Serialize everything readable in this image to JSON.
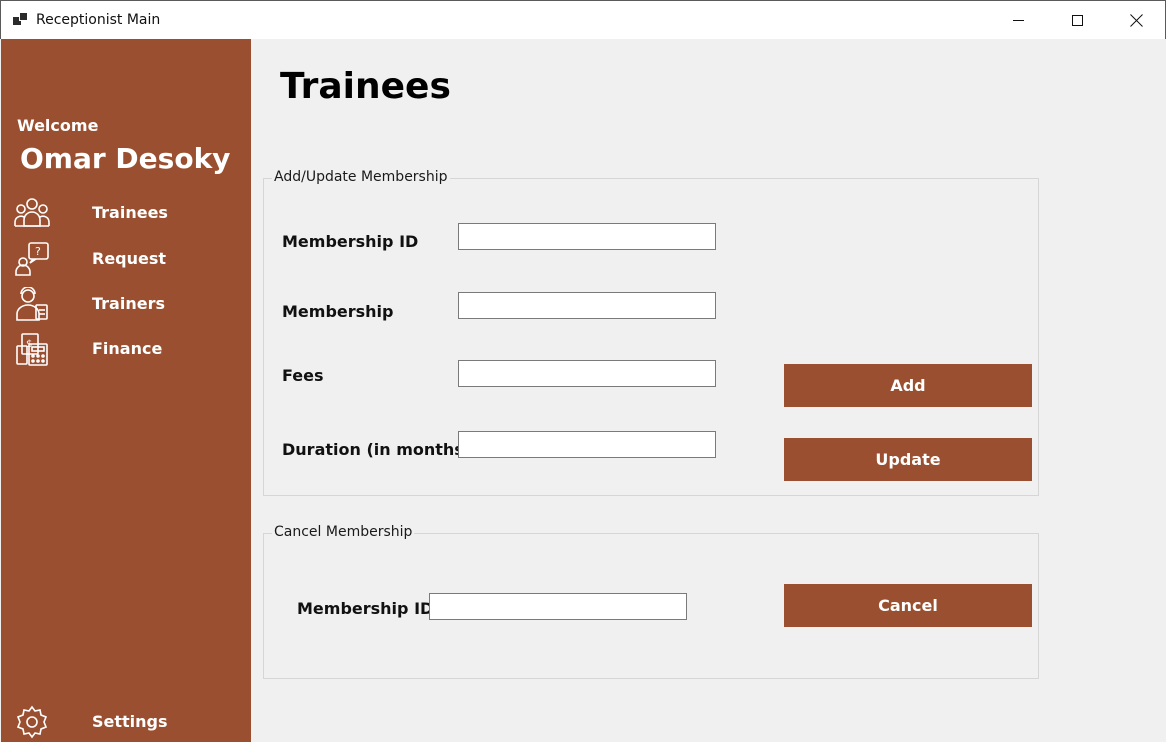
{
  "window": {
    "title": "Receptionist Main"
  },
  "sidebar": {
    "welcome": "Welcome",
    "user_name": "Omar Desoky",
    "items": [
      {
        "label": "Trainees",
        "icon": "trainees-group-icon"
      },
      {
        "label": "Request",
        "icon": "request-question-icon"
      },
      {
        "label": "Trainers",
        "icon": "trainer-icon"
      },
      {
        "label": "Finance",
        "icon": "finance-calculator-icon"
      }
    ],
    "settings": {
      "label": "Settings",
      "icon": "gear-icon"
    }
  },
  "main": {
    "title": "Trainees",
    "add_update_group": {
      "legend": "Add/Update Membership",
      "fields": [
        {
          "label": "Membership ID",
          "value": ""
        },
        {
          "label": "Membership",
          "value": ""
        },
        {
          "label": "Fees",
          "value": ""
        },
        {
          "label": "Duration (in months)",
          "value": ""
        }
      ],
      "add_button": "Add",
      "update_button": "Update"
    },
    "cancel_group": {
      "legend": "Cancel Membership",
      "field_label": "Membership ID",
      "field_value": "",
      "cancel_button": "Cancel"
    }
  },
  "colors": {
    "accent": "#9a5030",
    "background": "#f0f0f0"
  }
}
